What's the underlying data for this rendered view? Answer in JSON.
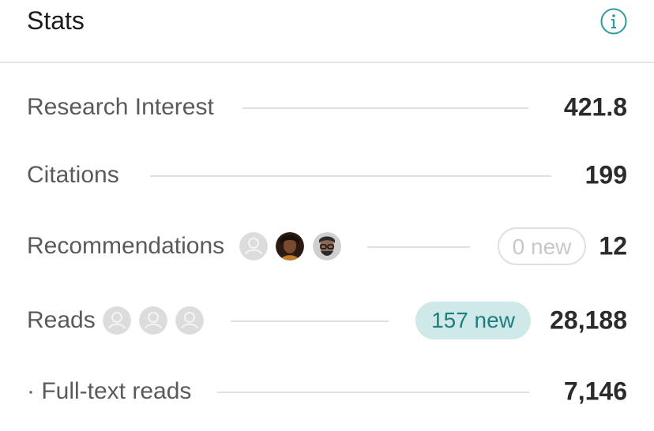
{
  "header": {
    "title": "Stats",
    "info_icon": "info-icon"
  },
  "stats": {
    "research_interest": {
      "label": "Research Interest",
      "value": "421.8"
    },
    "citations": {
      "label": "Citations",
      "value": "199"
    },
    "recommendations": {
      "label": "Recommendations",
      "badge": "0 new",
      "value": "12",
      "avatars": [
        "placeholder-avatar",
        "user-photo-avatar",
        "user-photo-avatar"
      ]
    },
    "reads": {
      "label": "Reads",
      "badge": "157 new",
      "value": "28,188",
      "avatars": [
        "placeholder-avatar",
        "placeholder-avatar",
        "placeholder-avatar"
      ]
    },
    "full_text_reads": {
      "label": "· Full-text reads",
      "value": "7,146"
    }
  },
  "colors": {
    "accent": "#2a9c9c",
    "badge_bg": "#cfe9e8",
    "badge_text": "#1f7d80"
  }
}
